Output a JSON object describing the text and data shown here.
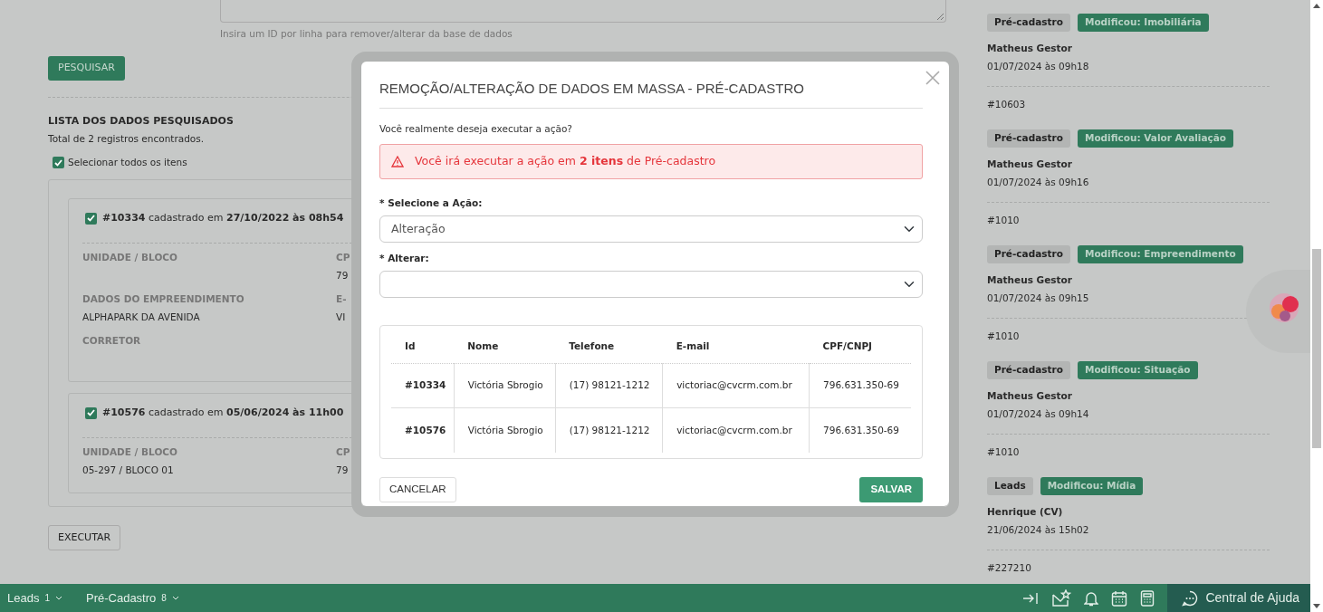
{
  "search_form": {
    "hint": "Insira um ID por linha para remover/alterar da base de dados",
    "search_button": "PESQUISAR"
  },
  "results": {
    "heading": "LISTA DOS DADOS PESQUISADOS",
    "total": "Total de 2 registros encontrados.",
    "select_all": {
      "label": "Selecionar todos os itens",
      "checked": true
    },
    "items": [
      {
        "checked": true,
        "title": "**#10334** cadastrado em **27/10/2022 às 08h54**",
        "rows": [
          [
            {
              "label": "UNIDADE / BLOCO"
            },
            {
              "label": "CP",
              "value": "79"
            }
          ],
          [
            {
              "label": "DADOS DO EMPREENDIMENTO",
              "value": "ALPHAPARK DA AVENIDA"
            },
            {
              "label": "E-",
              "value": "VI"
            }
          ],
          [
            {
              "label": "CORRETOR"
            }
          ]
        ]
      },
      {
        "checked": true,
        "title": "**#10576** cadastrado em **05/06/2024 às 11h00**",
        "rows": [
          [
            {
              "label": "UNIDADE / BLOCO",
              "value": "05-297 / BLOCO 01"
            },
            {
              "label": "CP",
              "value": "79"
            }
          ]
        ]
      }
    ]
  },
  "execute_button": "EXECUTAR",
  "activity_feed": [
    {
      "module": "Pré-cadastro",
      "change": "Modificou: Imobiliária",
      "user": "Matheus Gestor",
      "date": "01/07/2024 às 09h18",
      "ref": "#10603"
    },
    {
      "module": "Pré-cadastro",
      "change": "Modificou: Valor Avaliação",
      "user": "Matheus Gestor",
      "date": "01/07/2024 às 09h16",
      "ref": "#1010"
    },
    {
      "module": "Pré-cadastro",
      "change": "Modificou: Empreendimento",
      "user": "Matheus Gestor",
      "date": "01/07/2024 às 09h15",
      "ref": "#1010"
    },
    {
      "module": "Pré-cadastro",
      "change": "Modificou: Situação",
      "user": "Matheus Gestor",
      "date": "01/07/2024 às 09h14",
      "ref": "#1010"
    },
    {
      "module": "Leads",
      "change": "Modificou: Mídia",
      "user": "Henrique (CV)",
      "date": "21/06/2024 às 15h02",
      "ref": "#227210"
    }
  ],
  "modal": {
    "title": "REMOÇÃO/ALTERAÇÃO DE DADOS EM MASSA - PRÉ-CADASTRO",
    "question": "Você realmente deseja executar a ação?",
    "alert": "Você irá executar a ação em **2 itens** de Pré-cadastro",
    "action_field": {
      "label": "* Selecione a Ação:",
      "value": "Alteração"
    },
    "change_field": {
      "label": "* Alterar:"
    },
    "table": {
      "columns": [
        "Id",
        "Nome",
        "Telefone",
        "E-mail",
        "CPF/CNPJ"
      ],
      "rows": [
        [
          "#10334",
          "Victória Sbrogio",
          "(17) 98121-1212",
          "victoriac@cvcrm.com.br",
          "796.631.350-69"
        ],
        [
          "#10576",
          "Victória Sbrogio",
          "(17) 98121-1212",
          "victoriac@cvcrm.com.br",
          "796.631.350-69"
        ]
      ]
    },
    "cancel_button": "CANCELAR",
    "save_button": "SALVAR"
  },
  "bottom_bar": {
    "tabs": [
      {
        "label": "Leads",
        "count": "1"
      },
      {
        "label": "Pré-Cadastro",
        "count": "8"
      }
    ],
    "help": "Central de Ajuda"
  }
}
